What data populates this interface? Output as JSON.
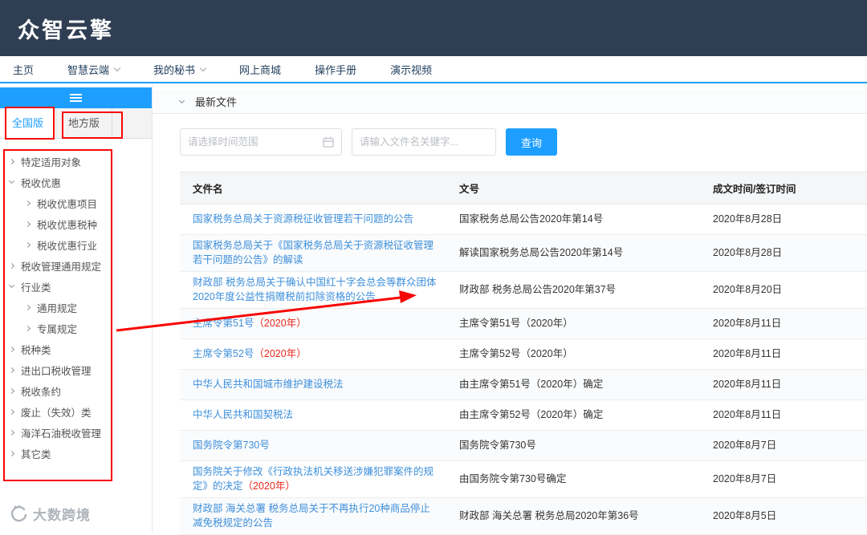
{
  "brand": {
    "logo_text": "众智云擎"
  },
  "nav": {
    "items": [
      {
        "label": "主页"
      },
      {
        "label": "智慧云端"
      },
      {
        "label": "我的秘书"
      },
      {
        "label": "网上商城"
      },
      {
        "label": "操作手册"
      },
      {
        "label": "演示视频"
      }
    ]
  },
  "sidebar": {
    "tabs": [
      {
        "label": "全国版",
        "active": true
      },
      {
        "label": "地方版",
        "active": false
      }
    ],
    "tree": {
      "items": [
        {
          "label": "特定适用对象"
        },
        {
          "label": "税收优惠"
        },
        {
          "label": "税收优惠项目"
        },
        {
          "label": "税收优惠税种"
        },
        {
          "label": "税收优惠行业"
        },
        {
          "label": "税收管理通用规定"
        },
        {
          "label": "行业类"
        },
        {
          "label": "通用规定"
        },
        {
          "label": "专属规定"
        },
        {
          "label": "税种类"
        },
        {
          "label": "进出口税收管理"
        },
        {
          "label": "税收条约"
        },
        {
          "label": "废止（失效）类"
        },
        {
          "label": "海洋石油税收管理"
        },
        {
          "label": "其它类"
        }
      ]
    }
  },
  "panel": {
    "title": "最新文件"
  },
  "search": {
    "date_placeholder": "请选择时间范围",
    "keyword_placeholder": "请输入文件名关键字...",
    "button_label": "查询"
  },
  "table": {
    "headers": [
      "文件名",
      "文号",
      "成文时间/签订时间"
    ],
    "rows": [
      {
        "name": "国家税务总局关于资源税征收管理若干问题的公告",
        "doc": "国家税务总局公告2020年第14号",
        "date": "2020年8月28日"
      },
      {
        "name": "国家税务总局关于《国家税务总局关于资源税征收管理若干问题的公告》的解读",
        "doc": "解读国家税务总局公告2020年第14号",
        "date": "2020年8月28日"
      },
      {
        "name": "财政部 税务总局关于确认中国红十字会总会等群众团体2020年度公益性捐赠税前扣除资格的公告",
        "doc": "财政部 税务总局公告2020年第37号",
        "date": "2020年8月20日"
      },
      {
        "name": "主席令第51号",
        "name_red": "（2020年）",
        "doc": "主席令第51号（2020年）",
        "date": "2020年8月11日"
      },
      {
        "name": "主席令第52号",
        "name_red": "（2020年）",
        "doc": "主席令第52号（2020年）",
        "date": "2020年8月11日"
      },
      {
        "name": "中华人民共和国城市维护建设税法",
        "doc": "由主席令第51号（2020年）确定",
        "date": "2020年8月11日"
      },
      {
        "name": "中华人民共和国契税法",
        "doc": "由主席令第52号（2020年）确定",
        "date": "2020年8月11日"
      },
      {
        "name": "国务院令第730号",
        "doc": "国务院令第730号",
        "date": "2020年8月7日"
      },
      {
        "name": "国务院关于修改《行政执法机关移送涉嫌犯罪案件的规定》的决定",
        "name_red": "（2020年）",
        "doc": "由国务院令第730号确定",
        "date": "2020年8月7日"
      },
      {
        "name": "财政部 海关总署 税务总局关于不再执行20种商品停止减免税规定的公告",
        "doc": "财政部 海关总署 税务总局2020年第36号",
        "date": "2020年8月5日"
      }
    ]
  },
  "watermark": {
    "text": "大数跨境"
  },
  "colors": {
    "topbar_bg": "#2f3e52",
    "accent_blue": "#1e9fff",
    "link_blue": "#3d8fdb",
    "annotation_red": "#f80606",
    "highlight_red_text": "#e8271c"
  }
}
